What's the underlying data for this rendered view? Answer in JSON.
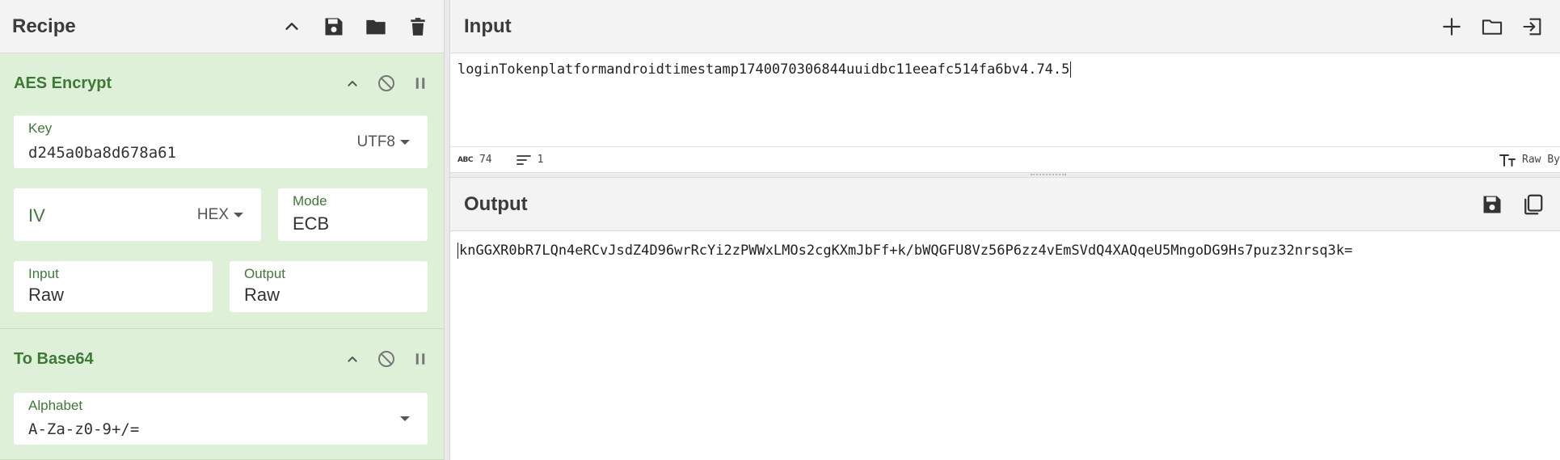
{
  "recipe": {
    "title": "Recipe",
    "operations": [
      {
        "name": "AES Encrypt",
        "key": {
          "label": "Key",
          "value": "d245a0ba8d678a61",
          "encoding": "UTF8"
        },
        "iv": {
          "label": "IV",
          "value": "",
          "encoding": "HEX"
        },
        "mode": {
          "label": "Mode",
          "value": "ECB"
        },
        "input": {
          "label": "Input",
          "value": "Raw"
        },
        "output": {
          "label": "Output",
          "value": "Raw"
        }
      },
      {
        "name": "To Base64",
        "alphabet": {
          "label": "Alphabet",
          "value": "A-Za-z0-9+/="
        }
      }
    ]
  },
  "input": {
    "title": "Input",
    "text": "loginTokenplatformandroidtimestamp1740070306844uuidbc11eeafc514fa6bv4.74.5",
    "length": "74",
    "lines": "1",
    "format": "Raw By"
  },
  "output": {
    "title": "Output",
    "text": "knGGXR0bR7LQn4eRCvJsdZ4D96wrRcYi2zPWWxLMOs2cgKXmJbFf+k/bWQGFU8Vz56P6zz4vEmSVdQ4XAQqeU5MngoDG9Hs7puz32nrsq3k="
  },
  "colors": {
    "accent_green": "#3d7a37",
    "op_background": "#dff0d8",
    "panel_background": "#f2f2f2"
  }
}
